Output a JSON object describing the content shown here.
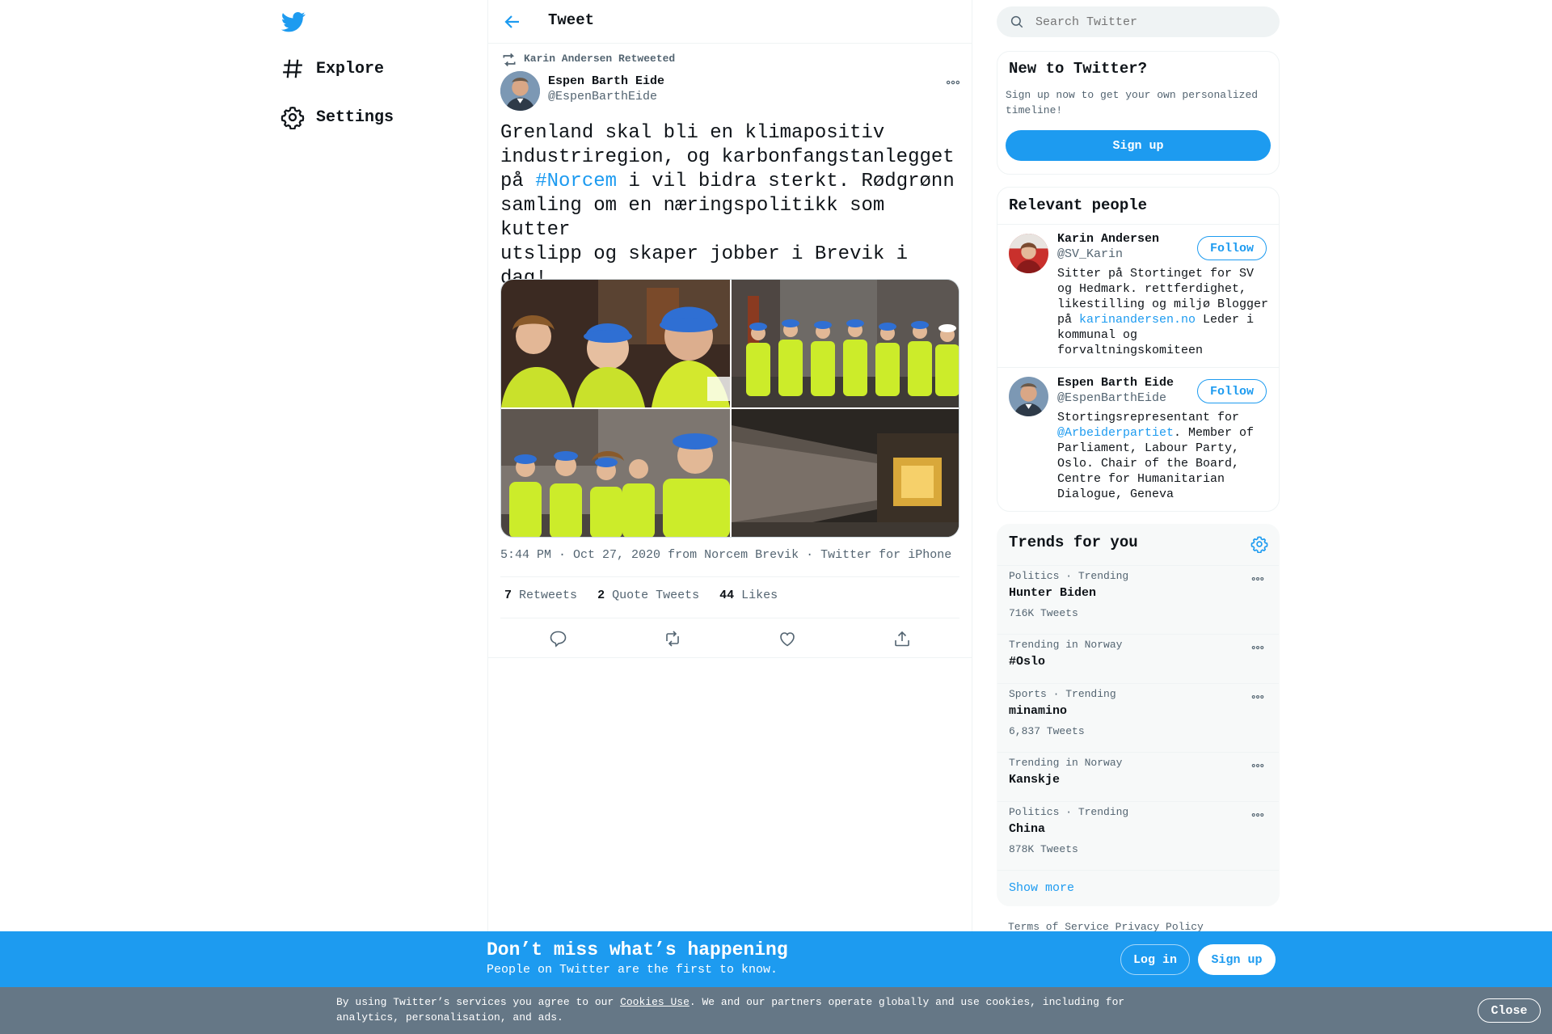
{
  "nav": {
    "explore_label": "Explore",
    "settings_label": "Settings"
  },
  "header": {
    "title": "Tweet"
  },
  "tweet": {
    "retweeted_by": "Karin Andersen Retweeted",
    "author_name": "Espen Barth Eide",
    "author_handle": "@EspenBarthEide",
    "text_line1": "Grenland skal bli en klimapositiv",
    "text_line2": "industriregion, og karbonfangstanlegget",
    "text_line3_pre": "på ",
    "text_hashtag": "#Norcem",
    "text_line3_post": " i vil bidra sterkt. Rødgrønn",
    "text_line4": "samling om en næringspolitikk som kutter",
    "text_line5": "utslipp og skaper jobber i Brevik i dag!",
    "emojis": "🌹🍀❤️💚🏭🌍",
    "time": "5:44 PM · Oct 27, 2020",
    "from_label": "from",
    "location": "Norcem Brevik",
    "dot": "·",
    "client": "Twitter for iPhone",
    "retweets_count": "7",
    "retweets_label": "Retweets",
    "quotes_count": "2",
    "quotes_label": "Quote Tweets",
    "likes_count": "44",
    "likes_label": "Likes"
  },
  "search": {
    "placeholder": "Search Twitter"
  },
  "signup_panel": {
    "title": "New to Twitter?",
    "subtitle": "Sign up now to get your own personalized timeline!",
    "button": "Sign up"
  },
  "relevant_people": {
    "title": "Relevant people",
    "people": [
      {
        "name": "Karin Andersen",
        "handle": "@SV_Karin",
        "follow": "Follow",
        "bio_pre": "Sitter på Stortinget for SV og Hedmark. rettferdighet, likestilling og miljø Blogger på ",
        "bio_link": "karinandersen.no",
        "bio_post": " Leder i kommunal og forvaltningskomiteen"
      },
      {
        "name": "Espen Barth Eide",
        "handle": "@EspenBarthEide",
        "follow": "Follow",
        "bio_pre": "Stortingsrepresentant for ",
        "bio_link": "@Arbeiderpartiet",
        "bio_post": ". Member of Parliament, Labour Party, Oslo. Chair of the Board, Centre for Humanitarian Dialogue, Geneva"
      }
    ]
  },
  "trends": {
    "title": "Trends for you",
    "items": [
      {
        "meta": "Politics · Trending",
        "name": "Hunter Biden",
        "count": "716K Tweets"
      },
      {
        "meta": "Trending in Norway",
        "name": "#Oslo",
        "count": ""
      },
      {
        "meta": "Sports · Trending",
        "name": "minamino",
        "count": "6,837 Tweets"
      },
      {
        "meta": "Trending in Norway",
        "name": "Kanskje",
        "count": ""
      },
      {
        "meta": "Politics · Trending",
        "name": "China",
        "count": "878K Tweets"
      }
    ],
    "show_more": "Show more"
  },
  "footer": {
    "terms": "Terms of Service",
    "privacy": "Privacy Policy"
  },
  "banner": {
    "title": "Don’t miss what’s happening",
    "subtitle": "People on Twitter are the first to know.",
    "login": "Log in",
    "signup": "Sign up"
  },
  "cookie": {
    "text_pre": "By using Twitter’s services you agree to our ",
    "link": "Cookies Use",
    "text_post": ". We and our partners operate globally and use cookies, including for analytics, personalisation, and ads.",
    "close": "Close"
  },
  "colors": {
    "accent": "#1d9bf0",
    "cookie_bg": "#657786"
  }
}
